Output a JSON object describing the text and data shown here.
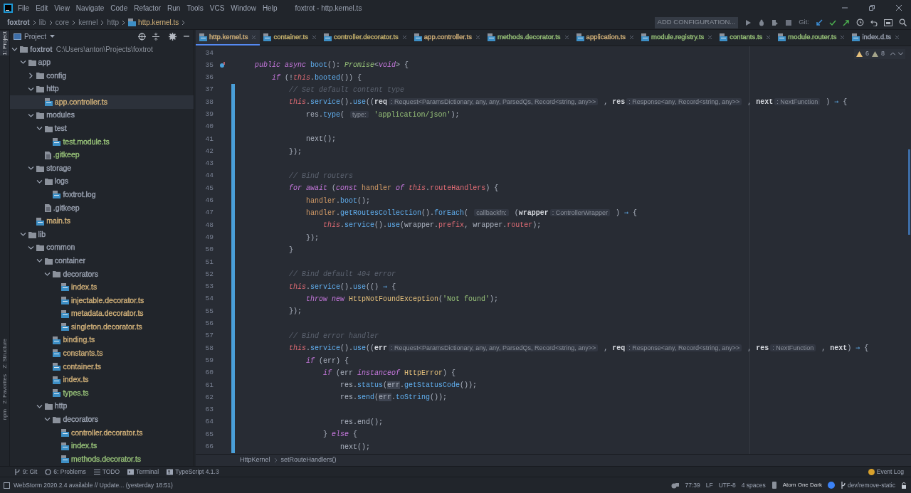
{
  "window": {
    "title": "foxtrot - http.kernel.ts"
  },
  "menu": [
    "File",
    "Edit",
    "View",
    "Navigate",
    "Code",
    "Refactor",
    "Run",
    "Tools",
    "VCS",
    "Window",
    "Help"
  ],
  "breadcrumb": [
    "foxtrot",
    "lib",
    "core",
    "kernel",
    "http",
    "http.kernel.ts"
  ],
  "toolbar": {
    "run_config": "ADD CONFIGURATION...",
    "git_label": "Git:"
  },
  "side_tabs": [
    {
      "label": "1: Project",
      "selected": true
    },
    {
      "label": "Z: Structure",
      "selected": false
    },
    {
      "label": "2: Favorites",
      "selected": false
    },
    {
      "label": "npm",
      "selected": false
    }
  ],
  "project": {
    "title": "Project",
    "tree": [
      {
        "kind": "folder",
        "label": "foxtrot",
        "path": "C:\\Users\\anton\\Projects\\foxtrot",
        "expanded": true,
        "selected": false,
        "children": [
          {
            "kind": "folder",
            "label": "app",
            "expanded": true,
            "selected": false,
            "children": [
              {
                "kind": "folder",
                "label": "config",
                "expanded": false,
                "selected": false
              },
              {
                "kind": "folder",
                "label": "http",
                "expanded": true,
                "selected": false,
                "children": [
                  {
                    "kind": "ts",
                    "label": "app.controller.ts",
                    "color": "#d3b27a",
                    "selected": true
                  }
                ]
              },
              {
                "kind": "folder",
                "label": "modules",
                "expanded": true,
                "selected": false,
                "children": [
                  {
                    "kind": "folder",
                    "label": "test",
                    "expanded": true,
                    "selected": false,
                    "children": [
                      {
                        "kind": "ts",
                        "label": "test.module.ts",
                        "color": "#98c379",
                        "selected": false
                      }
                    ]
                  },
                  {
                    "kind": "text",
                    "label": ".gitkeep",
                    "color": "#98c379",
                    "selected": false
                  }
                ]
              },
              {
                "kind": "folder",
                "label": "storage",
                "expanded": true,
                "selected": false,
                "children": [
                  {
                    "kind": "folder",
                    "label": "logs",
                    "expanded": true,
                    "selected": false,
                    "children": [
                      {
                        "kind": "ts",
                        "label": "foxtrot.log",
                        "color": "#9da5b4",
                        "selected": false
                      }
                    ]
                  },
                  {
                    "kind": "text",
                    "label": ".gitkeep",
                    "color": "#9da5b4",
                    "selected": false
                  }
                ]
              },
              {
                "kind": "ts",
                "label": "main.ts",
                "color": "#d3b27a",
                "selected": false
              }
            ]
          },
          {
            "kind": "folder",
            "label": "lib",
            "expanded": true,
            "selected": false,
            "children": [
              {
                "kind": "folder",
                "label": "common",
                "expanded": true,
                "selected": false,
                "children": [
                  {
                    "kind": "folder",
                    "label": "container",
                    "expanded": true,
                    "selected": false,
                    "children": [
                      {
                        "kind": "folder",
                        "label": "decorators",
                        "expanded": true,
                        "selected": false,
                        "children": [
                          {
                            "kind": "ts",
                            "label": "index.ts",
                            "color": "#d3b27a",
                            "selected": false
                          },
                          {
                            "kind": "ts",
                            "label": "injectable.decorator.ts",
                            "color": "#d3b27a",
                            "selected": false
                          },
                          {
                            "kind": "ts",
                            "label": "metadata.decorator.ts",
                            "color": "#d3b27a",
                            "selected": false
                          },
                          {
                            "kind": "ts",
                            "label": "singleton.decorator.ts",
                            "color": "#d3b27a",
                            "selected": false
                          }
                        ]
                      },
                      {
                        "kind": "ts",
                        "label": "binding.ts",
                        "color": "#d3b27a",
                        "selected": false
                      },
                      {
                        "kind": "ts",
                        "label": "constants.ts",
                        "color": "#d3b27a",
                        "selected": false
                      },
                      {
                        "kind": "ts",
                        "label": "container.ts",
                        "color": "#d3b27a",
                        "selected": false
                      },
                      {
                        "kind": "ts",
                        "label": "index.ts",
                        "color": "#d3b27a",
                        "selected": false
                      },
                      {
                        "kind": "ts",
                        "label": "types.ts",
                        "color": "#98c379",
                        "selected": false
                      }
                    ]
                  },
                  {
                    "kind": "folder",
                    "label": "http",
                    "expanded": true,
                    "selected": false,
                    "children": [
                      {
                        "kind": "folder",
                        "label": "decorators",
                        "expanded": true,
                        "selected": false,
                        "children": [
                          {
                            "kind": "ts",
                            "label": "controller.decorator.ts",
                            "color": "#d3b27a",
                            "selected": false
                          },
                          {
                            "kind": "ts",
                            "label": "index.ts",
                            "color": "#98c379",
                            "selected": false
                          },
                          {
                            "kind": "ts",
                            "label": "methods.decorator.ts",
                            "color": "#98c379",
                            "selected": false
                          }
                        ]
                      }
                    ]
                  }
                ]
              }
            ]
          }
        ]
      }
    ]
  },
  "tabs": [
    {
      "label": "http.kernel.ts",
      "color": "#d3b27a",
      "selected": true
    },
    {
      "label": "container.ts",
      "color": "#c9b46e",
      "selected": false
    },
    {
      "label": "controller.decorator.ts",
      "color": "#c9b46e",
      "selected": false
    },
    {
      "label": "app.controller.ts",
      "color": "#d3b27a",
      "selected": false
    },
    {
      "label": "methods.decorator.ts",
      "color": "#98c379",
      "selected": false
    },
    {
      "label": "application.ts",
      "color": "#d3b27a",
      "selected": false
    },
    {
      "label": "module.registry.ts",
      "color": "#98c379",
      "selected": false
    },
    {
      "label": "contants.ts",
      "color": "#98c379",
      "selected": false
    },
    {
      "label": "module.router.ts",
      "color": "#98c379",
      "selected": false
    },
    {
      "label": "index.d.ts",
      "color": "#9da5b4",
      "selected": false
    }
  ],
  "editor": {
    "inspections": {
      "warnings": "6",
      "weak_warnings": "8"
    },
    "lines": [
      {
        "n": "34",
        "changed": false,
        "override": false
      },
      {
        "n": "35",
        "changed": false,
        "override": true,
        "tokens": [
          {
            "kind": "k",
            "text": "    public async "
          },
          {
            "kind": "f",
            "text": "boot"
          },
          {
            "kind": "p",
            "text": "(): "
          },
          {
            "kind": "ty",
            "text": "Promise"
          },
          {
            "kind": "p",
            "text": "<"
          },
          {
            "kind": "k",
            "text": "void"
          },
          {
            "kind": "p",
            "text": "> {"
          }
        ]
      },
      {
        "n": "36",
        "changed": false,
        "override": false,
        "tokens": [
          {
            "kind": "k",
            "text": "        if"
          },
          {
            "kind": "p",
            "text": " (!"
          },
          {
            "kind": "t",
            "text": "this"
          },
          {
            "kind": "p",
            "text": "."
          },
          {
            "kind": "f",
            "text": "booted"
          },
          {
            "kind": "p",
            "text": "()) {"
          }
        ]
      },
      {
        "n": "37",
        "changed": true,
        "override": false,
        "tokens": [
          {
            "kind": "c",
            "text": "            // Set default content type"
          }
        ]
      },
      {
        "n": "38",
        "changed": true,
        "override": false,
        "tokens": [
          {
            "kind": "t",
            "text": "            this"
          },
          {
            "kind": "p",
            "text": "."
          },
          {
            "kind": "f",
            "text": "service"
          },
          {
            "kind": "p",
            "text": "()."
          },
          {
            "kind": "f",
            "text": "use"
          },
          {
            "kind": "p",
            "text": "(("
          },
          {
            "kind": "pa",
            "text": "req"
          },
          {
            "kind": "h",
            "text": ": Request<ParamsDictionary, any, any, ParsedQs, Record<string, any>>"
          },
          {
            "kind": "p",
            "text": " , "
          },
          {
            "kind": "pa",
            "text": "res"
          },
          {
            "kind": "h",
            "text": ": Response<any, Record<string, any>>"
          },
          {
            "kind": "p",
            "text": " , "
          },
          {
            "kind": "pa",
            "text": "next"
          },
          {
            "kind": "h",
            "text": ": NextFunction"
          },
          {
            "kind": "p",
            "text": " ) "
          },
          {
            "kind": "op",
            "text": "⇒"
          },
          {
            "kind": "p",
            "text": " {"
          }
        ]
      },
      {
        "n": "39",
        "changed": true,
        "override": false,
        "tokens": [
          {
            "kind": "p",
            "text": "                res."
          },
          {
            "kind": "f",
            "text": "type"
          },
          {
            "kind": "p",
            "text": "( "
          },
          {
            "kind": "h",
            "text": "type:"
          },
          {
            "kind": "s",
            "text": " 'application/json'"
          },
          {
            "kind": "p",
            "text": ");"
          }
        ]
      },
      {
        "n": "40",
        "changed": true,
        "override": false
      },
      {
        "n": "41",
        "changed": true,
        "override": false,
        "tokens": [
          {
            "kind": "p",
            "text": "                next();"
          }
        ]
      },
      {
        "n": "42",
        "changed": true,
        "override": false,
        "tokens": [
          {
            "kind": "p",
            "text": "            });"
          }
        ]
      },
      {
        "n": "43",
        "changed": true,
        "override": false
      },
      {
        "n": "44",
        "changed": true,
        "override": false,
        "tokens": [
          {
            "kind": "c",
            "text": "            // Bind routers"
          }
        ]
      },
      {
        "n": "45",
        "changed": true,
        "override": false,
        "tokens": [
          {
            "kind": "k",
            "text": "            for await"
          },
          {
            "kind": "p",
            "text": " ("
          },
          {
            "kind": "k",
            "text": "const "
          },
          {
            "kind": "v",
            "text": "handler "
          },
          {
            "kind": "k",
            "text": "of "
          },
          {
            "kind": "t",
            "text": "this"
          },
          {
            "kind": "p",
            "text": "."
          },
          {
            "kind": "pr",
            "text": "routeHandlers"
          },
          {
            "kind": "p",
            "text": ") {"
          }
        ]
      },
      {
        "n": "46",
        "changed": true,
        "override": false,
        "tokens": [
          {
            "kind": "v",
            "text": "                handler"
          },
          {
            "kind": "p",
            "text": "."
          },
          {
            "kind": "f",
            "text": "boot"
          },
          {
            "kind": "p",
            "text": "();"
          }
        ]
      },
      {
        "n": "47",
        "changed": true,
        "override": false,
        "tokens": [
          {
            "kind": "v",
            "text": "                handler"
          },
          {
            "kind": "p",
            "text": "."
          },
          {
            "kind": "f",
            "text": "getRoutesCollection"
          },
          {
            "kind": "p",
            "text": "()."
          },
          {
            "kind": "f",
            "text": "forEach"
          },
          {
            "kind": "p",
            "text": "( "
          },
          {
            "kind": "h",
            "text": "callbackfn:"
          },
          {
            "kind": "p",
            "text": " ("
          },
          {
            "kind": "pa",
            "text": "wrapper"
          },
          {
            "kind": "h",
            "text": ": ControllerWrapper"
          },
          {
            "kind": "p",
            "text": " ) "
          },
          {
            "kind": "op",
            "text": "⇒"
          },
          {
            "kind": "p",
            "text": " {"
          }
        ]
      },
      {
        "n": "48",
        "changed": true,
        "override": false,
        "tokens": [
          {
            "kind": "t",
            "text": "                    this"
          },
          {
            "kind": "p",
            "text": "."
          },
          {
            "kind": "f",
            "text": "service"
          },
          {
            "kind": "p",
            "text": "()."
          },
          {
            "kind": "f",
            "text": "use"
          },
          {
            "kind": "p",
            "text": "(wrapper."
          },
          {
            "kind": "pr",
            "text": "prefix"
          },
          {
            "kind": "p",
            "text": ", wrapper."
          },
          {
            "kind": "pr",
            "text": "router"
          },
          {
            "kind": "p",
            "text": ");"
          }
        ]
      },
      {
        "n": "49",
        "changed": true,
        "override": false,
        "tokens": [
          {
            "kind": "p",
            "text": "                });"
          }
        ]
      },
      {
        "n": "50",
        "changed": true,
        "override": false,
        "tokens": [
          {
            "kind": "p",
            "text": "            }"
          }
        ]
      },
      {
        "n": "51",
        "changed": true,
        "override": false
      },
      {
        "n": "52",
        "changed": true,
        "override": false,
        "tokens": [
          {
            "kind": "c",
            "text": "            // Bind default 404 error"
          }
        ]
      },
      {
        "n": "53",
        "changed": true,
        "override": false,
        "tokens": [
          {
            "kind": "t",
            "text": "            this"
          },
          {
            "kind": "p",
            "text": "."
          },
          {
            "kind": "f",
            "text": "service"
          },
          {
            "kind": "p",
            "text": "()."
          },
          {
            "kind": "f",
            "text": "use"
          },
          {
            "kind": "p",
            "text": "(() "
          },
          {
            "kind": "op",
            "text": "⇒"
          },
          {
            "kind": "p",
            "text": " {"
          }
        ]
      },
      {
        "n": "54",
        "changed": true,
        "override": false,
        "tokens": [
          {
            "kind": "k",
            "text": "                throw new "
          },
          {
            "kind": "cl",
            "text": "HttpNotFoundException"
          },
          {
            "kind": "p",
            "text": "("
          },
          {
            "kind": "s",
            "text": "'Not found'"
          },
          {
            "kind": "p",
            "text": ");"
          }
        ]
      },
      {
        "n": "55",
        "changed": true,
        "override": false,
        "tokens": [
          {
            "kind": "p",
            "text": "            });"
          }
        ]
      },
      {
        "n": "56",
        "changed": true,
        "override": false
      },
      {
        "n": "57",
        "changed": true,
        "override": false,
        "tokens": [
          {
            "kind": "c",
            "text": "            // Bind error handler"
          }
        ]
      },
      {
        "n": "58",
        "changed": true,
        "override": false,
        "tokens": [
          {
            "kind": "t",
            "text": "            this"
          },
          {
            "kind": "p",
            "text": "."
          },
          {
            "kind": "f",
            "text": "service"
          },
          {
            "kind": "p",
            "text": "()."
          },
          {
            "kind": "f",
            "text": "use"
          },
          {
            "kind": "p",
            "text": "(("
          },
          {
            "kind": "pa",
            "text": "err"
          },
          {
            "kind": "h",
            "text": ": Request<ParamsDictionary, any, any, ParsedQs, Record<string, any>>"
          },
          {
            "kind": "p",
            "text": " , "
          },
          {
            "kind": "pa",
            "text": "req"
          },
          {
            "kind": "h",
            "text": ": Response<any, Record<string, any>>"
          },
          {
            "kind": "p",
            "text": " , "
          },
          {
            "kind": "pa",
            "text": "res"
          },
          {
            "kind": "h",
            "text": ": NextFunction"
          },
          {
            "kind": "p",
            "text": " , "
          },
          {
            "kind": "pa",
            "text": "next"
          },
          {
            "kind": "p",
            "text": ") "
          },
          {
            "kind": "op",
            "text": "⇒"
          },
          {
            "kind": "p",
            "text": " {"
          }
        ]
      },
      {
        "n": "59",
        "changed": true,
        "override": false,
        "tokens": [
          {
            "kind": "k",
            "text": "                if"
          },
          {
            "kind": "p",
            "text": " (err) {"
          }
        ]
      },
      {
        "n": "60",
        "changed": true,
        "override": false,
        "tokens": [
          {
            "kind": "k",
            "text": "                    if"
          },
          {
            "kind": "p",
            "text": " (err "
          },
          {
            "kind": "k",
            "text": "instanceof "
          },
          {
            "kind": "cl",
            "text": "HttpError"
          },
          {
            "kind": "p",
            "text": ") {"
          }
        ]
      },
      {
        "n": "61",
        "changed": true,
        "override": false,
        "tokens": [
          {
            "kind": "p",
            "text": "                        res."
          },
          {
            "kind": "f",
            "text": "status"
          },
          {
            "kind": "p",
            "text": "("
          },
          {
            "kind": "hl",
            "text": "err"
          },
          {
            "kind": "p",
            "text": "."
          },
          {
            "kind": "f",
            "text": "getStatusCode"
          },
          {
            "kind": "p",
            "text": "());"
          }
        ]
      },
      {
        "n": "62",
        "changed": true,
        "override": false,
        "tokens": [
          {
            "kind": "p",
            "text": "                        res."
          },
          {
            "kind": "f",
            "text": "send"
          },
          {
            "kind": "p",
            "text": "("
          },
          {
            "kind": "hl",
            "text": "err"
          },
          {
            "kind": "p",
            "text": "."
          },
          {
            "kind": "f",
            "text": "toString"
          },
          {
            "kind": "p",
            "text": "());"
          }
        ]
      },
      {
        "n": "63",
        "changed": true,
        "override": false
      },
      {
        "n": "64",
        "changed": true,
        "override": false,
        "tokens": [
          {
            "kind": "p",
            "text": "                        res.end();"
          }
        ]
      },
      {
        "n": "65",
        "changed": true,
        "override": false,
        "tokens": [
          {
            "kind": "p",
            "text": "                    } "
          },
          {
            "kind": "k",
            "text": "else"
          },
          {
            "kind": "p",
            "text": " {"
          }
        ]
      },
      {
        "n": "66",
        "changed": true,
        "override": false,
        "tokens": [
          {
            "kind": "p",
            "text": "                        next();"
          }
        ]
      }
    ],
    "breadcrumb": [
      "HttpKernel",
      "setRouteHandlers()"
    ]
  },
  "tool_windows": [
    {
      "kind": "git",
      "label": "9: Git"
    },
    {
      "kind": "problems",
      "label": "6: Problems"
    },
    {
      "kind": "todo",
      "label": "TODO"
    },
    {
      "kind": "terminal",
      "label": "Terminal"
    },
    {
      "kind": "typescript",
      "label": "TypeScript 4.1.3"
    }
  ],
  "event_log": "Event Log",
  "status": {
    "message": "WebStorm 2020.2.4 available // Update... (yesterday 18:51)",
    "position": "77:39",
    "line_sep": "LF",
    "encoding": "UTF-8",
    "indent": "4 spaces",
    "theme": "Atom One Dark",
    "branch": "dev/remove-static"
  }
}
